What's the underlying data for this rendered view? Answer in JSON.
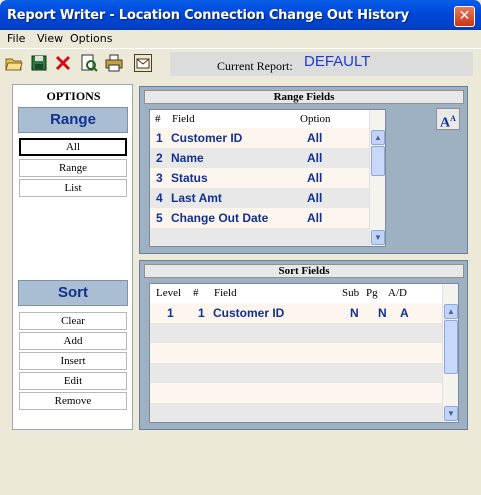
{
  "window": {
    "title": "Report Writer - Location Connection Change Out History",
    "close_label": "✕"
  },
  "menu": {
    "items": [
      "File",
      "View",
      "Options"
    ]
  },
  "toolbar": {
    "icons": [
      "open-folder-icon",
      "save-icon",
      "delete-icon",
      "preview-icon",
      "print-icon",
      "mail-icon"
    ],
    "current_report_label": "Current Report:",
    "current_report_value": "DEFAULT"
  },
  "options": {
    "title": "OPTIONS",
    "range_header": "Range",
    "range_buttons": [
      "All",
      "Range",
      "List"
    ],
    "sort_header": "Sort",
    "sort_buttons": [
      "Clear",
      "Add",
      "Insert",
      "Edit",
      "Remove"
    ]
  },
  "range_fields": {
    "header": "Range Fields",
    "col_num": "#",
    "col_field": "Field",
    "col_option": "Option",
    "font_button": "A",
    "rows": [
      {
        "num": "1",
        "field": "Customer ID",
        "option": "All"
      },
      {
        "num": "2",
        "field": "Name",
        "option": "All"
      },
      {
        "num": "3",
        "field": "Status",
        "option": "All"
      },
      {
        "num": "4",
        "field": "Last Amt",
        "option": "All"
      },
      {
        "num": "5",
        "field": "Change Out Date",
        "option": "All"
      }
    ]
  },
  "sort_fields": {
    "header": "Sort Fields",
    "col_level": "Level",
    "col_num": "#",
    "col_field": "Field",
    "col_sub": "Sub",
    "col_pg": "Pg",
    "col_ad": "A/D",
    "rows": [
      {
        "level": "1",
        "num": "1",
        "field": "Customer ID",
        "sub": "N",
        "pg": "N",
        "ad": "A"
      }
    ]
  },
  "colors": {
    "accent": "#10318f",
    "panel": "#9db1c3",
    "row_alt": "#fdf6ee"
  }
}
